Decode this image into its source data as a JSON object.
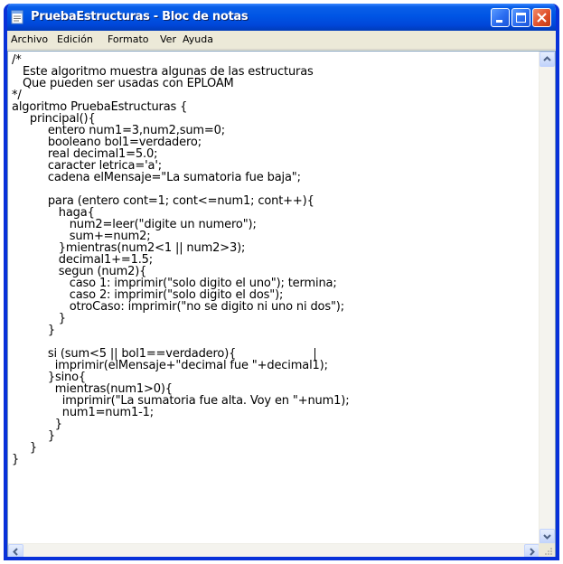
{
  "window": {
    "title": "PruebaEstructuras - Bloc de notas"
  },
  "menu": {
    "items": [
      "Archivo",
      "Edición",
      "Formato",
      "Ver",
      "Ayuda"
    ]
  },
  "editor": {
    "lines": [
      "/*",
      "   Este algoritmo muestra algunas de las estructuras",
      "   Que pueden ser usadas con EPLOAM",
      "*/",
      "algoritmo PruebaEstructuras {",
      "     principal(){",
      "          entero num1=3,num2,sum=0;",
      "          booleano bol1=verdadero;",
      "          real decimal1=5.0;",
      "          caracter letrica='a';",
      "          cadena elMensaje=\"La sumatoria fue baja\";",
      "",
      "          para (entero cont=1; cont<=num1; cont++){",
      "             haga{",
      "                num2=leer(\"digite un numero\");",
      "                sum+=num2;",
      "             }mientras(num2<1 || num2>3);",
      "             decimal1+=1.5;",
      "             segun (num2){",
      "                caso 1: imprimir(\"solo digito el uno\"); termina;",
      "                caso 2: imprimir(\"solo digito el dos\");",
      "                otroCaso: imprimir(\"no se digito ni uno ni dos\");",
      "             }",
      "          }",
      "",
      "          si (sum<5 || bol1==verdadero){",
      "            imprimir(elMensaje+\"decimal fue \"+decimal1);",
      "          }sino{",
      "            mientras(num1>0){",
      "              imprimir(\"La sumatoria fue alta. Voy en \"+num1);",
      "              num1=num1-1;",
      "            }",
      "          }",
      "     }",
      "}"
    ]
  }
}
